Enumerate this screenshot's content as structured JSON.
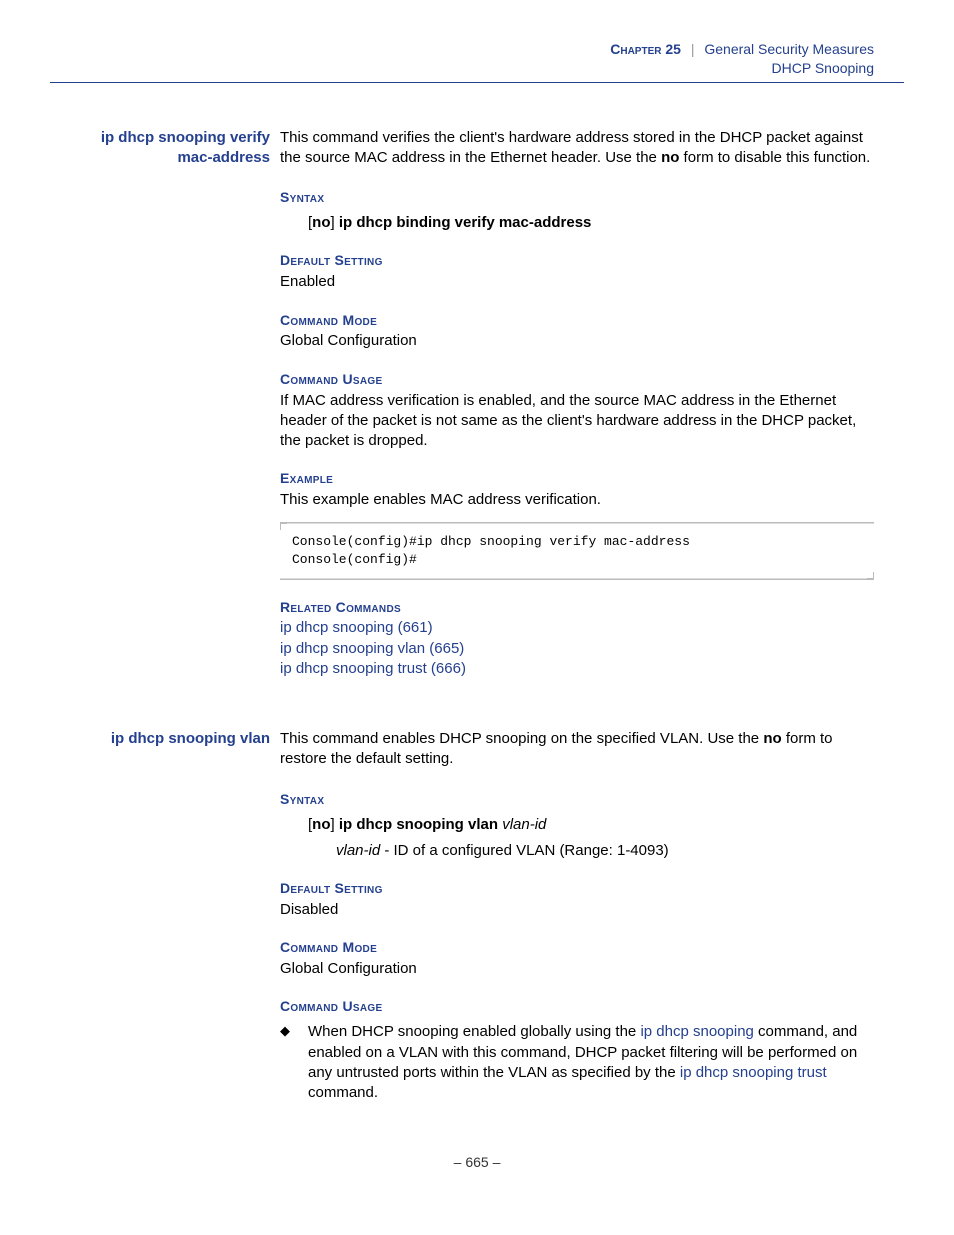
{
  "header": {
    "chapter_label": "Chapter 25",
    "separator": "|",
    "chapter_title": "General Security Measures",
    "subtitle": "DHCP Snooping"
  },
  "sections": [
    {
      "side_heading": "ip dhcp snooping verify mac-address",
      "desc_parts": {
        "p1": "This command verifies the client's hardware address stored in the DHCP packet against the source MAC address in the Ethernet header. Use the ",
        "no": "no",
        "p2": " form to disable this function."
      },
      "syntax_label": "Syntax",
      "syntax_line": {
        "pre": "[",
        "no": "no",
        "mid": "] ",
        "cmd": "ip dhcp binding verify mac-address"
      },
      "default_label": "Default Setting",
      "default_value": "Enabled",
      "mode_label": "Command Mode",
      "mode_value": "Global Configuration",
      "usage_label": "Command Usage",
      "usage_text": "If MAC address verification is enabled, and the source MAC address in the Ethernet header of the packet is not same as the client's hardware address in the DHCP packet, the packet is dropped.",
      "example_label": "Example",
      "example_intro": "This example enables MAC address verification.",
      "example_code": "Console(config)#ip dhcp snooping verify mac-address\nConsole(config)#",
      "related_label": "Related Commands",
      "related": [
        "ip dhcp snooping (661)",
        "ip dhcp snooping vlan (665)",
        "ip dhcp snooping trust (666)"
      ]
    },
    {
      "side_heading": "ip dhcp snooping vlan",
      "desc_parts": {
        "p1": "This command enables DHCP snooping on the specified VLAN. Use the ",
        "no": "no",
        "p2": " form to restore the default setting."
      },
      "syntax_label": "Syntax",
      "syntax_line": {
        "pre": "[",
        "no": "no",
        "mid": "] ",
        "cmd": "ip dhcp snooping vlan ",
        "arg": "vlan-id"
      },
      "syntax_desc": {
        "arg": "vlan-id",
        "rest": " - ID of a configured VLAN (Range: 1-4093)"
      },
      "default_label": "Default Setting",
      "default_value": "Disabled",
      "mode_label": "Command Mode",
      "mode_value": "Global Configuration",
      "usage_label": "Command Usage",
      "usage_bullet": {
        "p1": "When DHCP snooping enabled globally using the ",
        "link1": "ip dhcp snooping",
        "p2": " command, and enabled on a VLAN with this command, DHCP packet filtering will be performed on any untrusted ports within the VLAN as specified by the ",
        "link2": "ip dhcp snooping trust",
        "p3": " command."
      }
    }
  ],
  "footer": "–  665  –"
}
